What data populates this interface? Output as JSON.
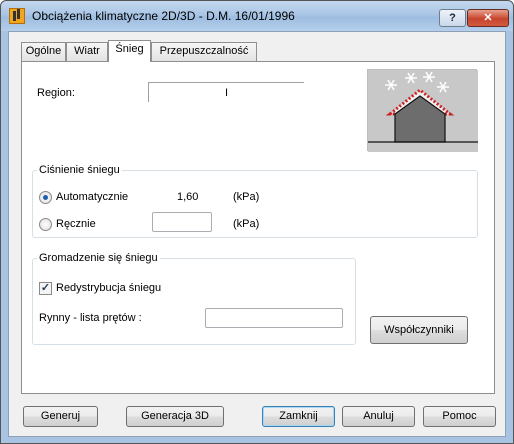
{
  "window": {
    "title": "Obciążenia klimatyczne 2D/3D - D.M. 16/01/1996",
    "help_label": "?",
    "close_label": "✕"
  },
  "tabs": [
    {
      "label": "Ogólne",
      "active": false
    },
    {
      "label": "Wiatr",
      "active": false
    },
    {
      "label": "Śnieg",
      "active": true
    },
    {
      "label": "Przepuszczalność",
      "active": false
    }
  ],
  "snow": {
    "region_label": "Region:",
    "region_value": "I",
    "pressure": {
      "legend": "Ciśnienie śniegu",
      "auto_label": "Automatycznie",
      "auto_value": "1,60",
      "auto_unit": "(kPa)",
      "manual_label": "Ręcznie",
      "manual_value": "",
      "manual_unit": "(kPa)",
      "selected": "auto"
    },
    "accumulation": {
      "legend": "Gromadzenie się śniegu",
      "redistribution_label": "Redystrybucja śniegu",
      "redistribution_checked": true,
      "gutters_label": "Rynny - lista prętów :",
      "gutters_value": ""
    },
    "coefficients_button": "Współczynniki"
  },
  "footer": {
    "generate": "Generuj",
    "generate3d": "Generacja 3D",
    "close": "Zamknij",
    "cancel": "Anuluj",
    "help": "Pomoc"
  },
  "colors": {
    "accent": "#3c7fb1",
    "roof_snow": "#cc2222",
    "preview_bg": "#c8c8c8"
  }
}
